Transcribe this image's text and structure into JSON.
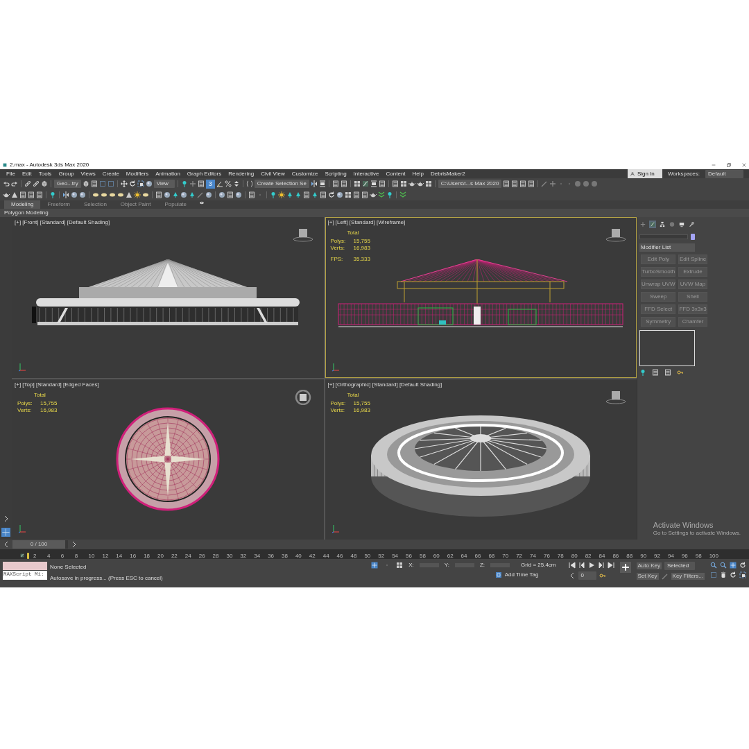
{
  "window": {
    "title": "2.max - Autodesk 3ds Max 2020"
  },
  "menu": [
    "File",
    "Edit",
    "Tools",
    "Group",
    "Views",
    "Create",
    "Modifiers",
    "Animation",
    "Graph Editors",
    "Rendering",
    "Civil View",
    "Customize",
    "Scripting",
    "Interactive",
    "Content",
    "Help",
    "DebrisMaker2"
  ],
  "sign_in": {
    "label": "Sign In"
  },
  "workspaces": {
    "label": "Workspaces:",
    "value": "Default"
  },
  "toolbar": {
    "dropdowns": [
      "Geo...try",
      "View",
      "Create Selection Se",
      "C:\\Users\\t...s Max 2020"
    ],
    "snap_toggle": {
      "label": "3",
      "on": true
    }
  },
  "ribbon_tabs": [
    {
      "label": "Modeling",
      "selected": true
    },
    {
      "label": "Freeform",
      "selected": false
    },
    {
      "label": "Selection",
      "selected": false
    },
    {
      "label": "Object Paint",
      "selected": false
    },
    {
      "label": "Populate",
      "selected": false
    }
  ],
  "ribbon_panel": "Polygon Modeling",
  "viewports": [
    {
      "label": "[+] [Front] [Standard] [Default Shading]",
      "kind": "front",
      "active": false
    },
    {
      "label": "[+] [Left] [Standard] [Wireframe]",
      "kind": "wireframe",
      "active": true,
      "stats": {
        "heading": "Total",
        "rows": [
          {
            "label": "Polys:",
            "value": "15,755"
          },
          {
            "label": "Verts:",
            "value": "16,983"
          }
        ],
        "fps": {
          "label": "FPS:",
          "value": "35.333"
        }
      }
    },
    {
      "label": "[+] [Top] [Standard] [Edged Faces]",
      "kind": "top",
      "active": false,
      "stats": {
        "heading": "Total",
        "rows": [
          {
            "label": "Polys:",
            "value": "15,755"
          },
          {
            "label": "Verts:",
            "value": "16,983"
          }
        ]
      }
    },
    {
      "label": "[+] [Orthographic] [Standard] [Default Shading]",
      "kind": "perspective",
      "active": false,
      "stats": {
        "heading": "Total",
        "rows": [
          {
            "label": "Polys:",
            "value": "15,755"
          },
          {
            "label": "Verts:",
            "value": "16,983"
          }
        ]
      }
    }
  ],
  "command_panel": {
    "tabs": [
      {
        "selected": false
      },
      {
        "selected": true
      },
      {
        "selected": false
      },
      {
        "selected": false
      },
      {
        "selected": false
      },
      {
        "selected": false
      }
    ],
    "modifier_list": "Modifier List",
    "modifier_buttons": [
      "Edit Poly",
      "Edit Spline",
      "TurboSmooth",
      "Extrude",
      "Unwrap UVW",
      "UVW Map",
      "Sweep",
      "Shell",
      "FFD Select",
      "FFD 3x3x3",
      "Symmetry",
      "Chamfer"
    ]
  },
  "timeline": {
    "position": "0 / 100",
    "level": 0,
    "track_labels": [
      "2",
      "4",
      "6",
      "8",
      "10",
      "12",
      "14",
      "16",
      "18",
      "20",
      "22",
      "24",
      "26",
      "28",
      "30",
      "32",
      "34",
      "36",
      "38",
      "40",
      "42",
      "44",
      "46",
      "48",
      "50",
      "52",
      "54",
      "56",
      "58",
      "60",
      "62",
      "64",
      "66",
      "68",
      "70",
      "72",
      "74",
      "76",
      "78",
      "80",
      "82",
      "84",
      "86",
      "88",
      "90",
      "92",
      "94",
      "96",
      "98",
      "100"
    ]
  },
  "status": {
    "listener": "MAXScript Mi:",
    "selection": "None Selected",
    "prompt": "Autosave in progress... (Press ESC to cancel)",
    "coords": [
      {
        "label": "X:"
      },
      {
        "label": "Y:"
      },
      {
        "label": "Z:"
      }
    ],
    "grid": "Grid = 25.4cm",
    "time_tag": "Add Time Tag",
    "frame": "0",
    "auto_key": "Auto Key",
    "key_mode": "Selected",
    "set_key": "Set Key",
    "key_filters": "Key Filters..."
  },
  "watermark": {
    "title": "Activate Windows",
    "text": "Go to Settings to activate Windows."
  }
}
